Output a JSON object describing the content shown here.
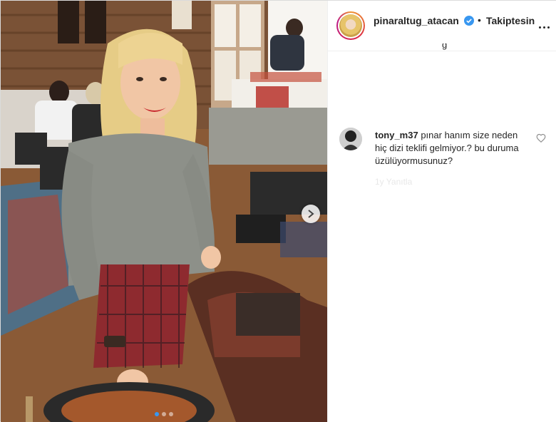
{
  "post": {
    "author": {
      "username": "pinaraltug_atacan",
      "verified": true,
      "follow_status": "Takiptesin",
      "separator": "•"
    },
    "caption_fragment": "g",
    "carousel": {
      "total": 3,
      "active": 1
    }
  },
  "comments": [
    {
      "username": "tony_m37",
      "text": "pınar hanım size neden hiç dizi teklifi gelmiyor.? bu duruma üzülüyormusunuz?",
      "meta": "1y Yanıtla"
    }
  ],
  "colors": {
    "accent_blue": "#3897f0",
    "text": "#262626",
    "border": "#dbdbdb"
  }
}
